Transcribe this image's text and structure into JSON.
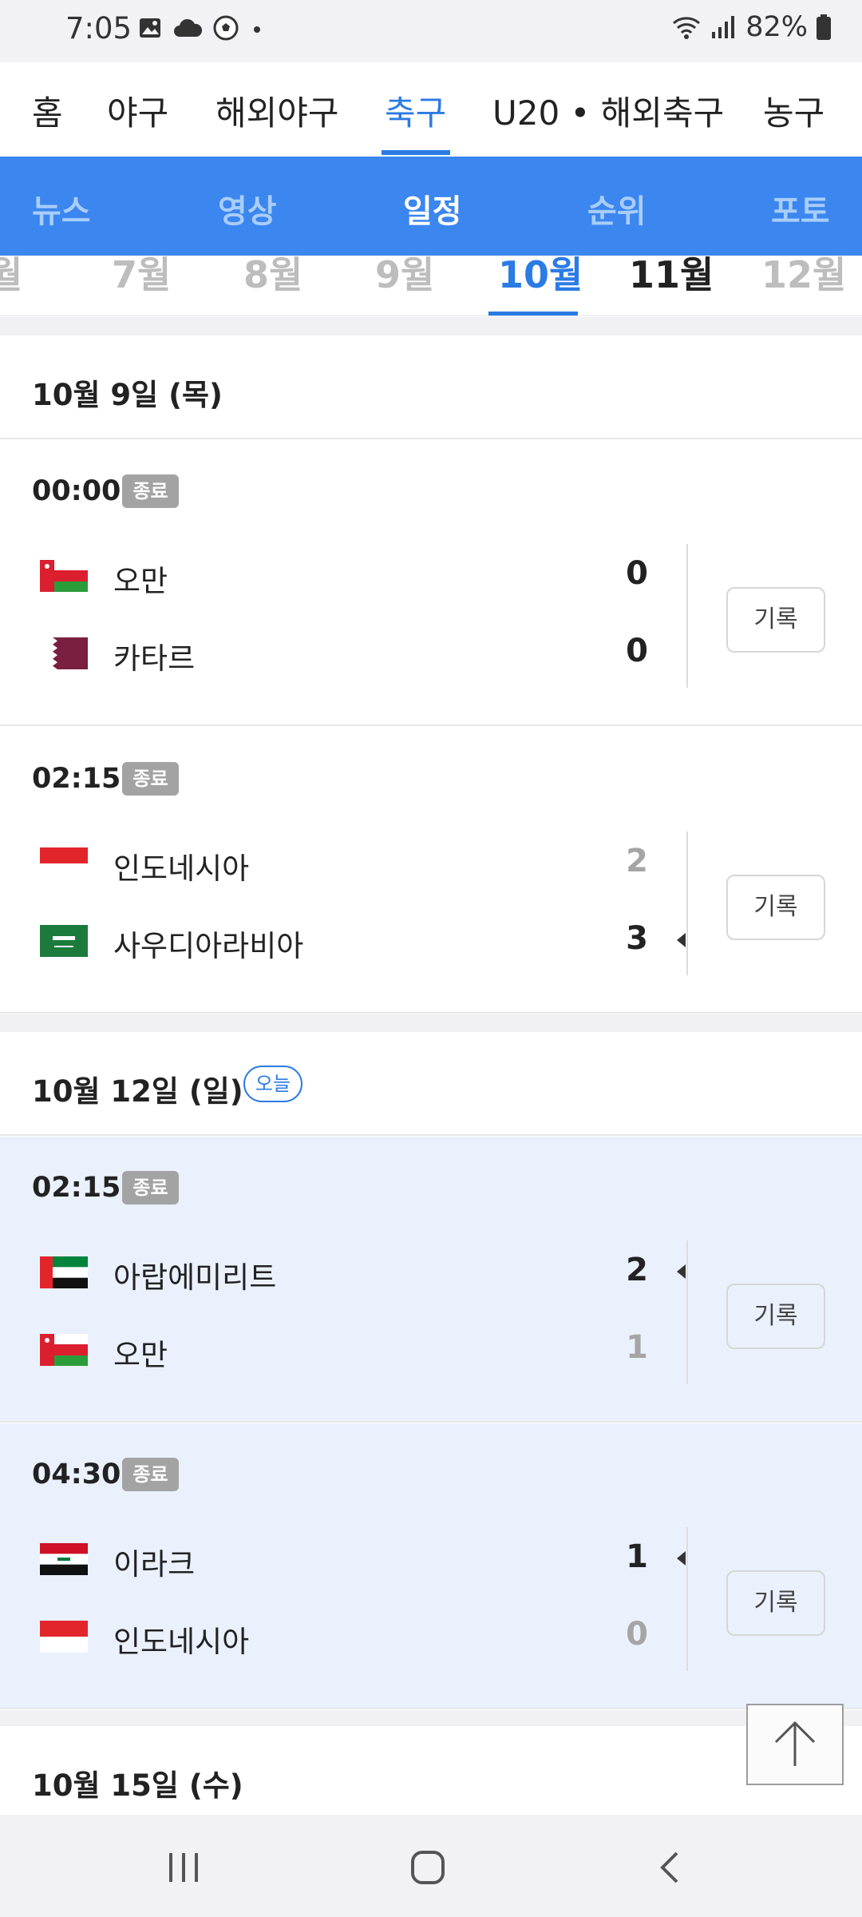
{
  "status_bar": {
    "time": "7:05",
    "battery": "82%"
  },
  "top_nav": {
    "items": [
      "홈",
      "야구",
      "해외야구",
      "축구",
      "U20 • 해외축구",
      "농구"
    ],
    "active": "축구"
  },
  "sub_nav": {
    "items": [
      "뉴스",
      "영상",
      "일정",
      "순위",
      "포토"
    ],
    "active": "일정"
  },
  "month_bar": {
    "items": [
      "월",
      "7월",
      "8월",
      "9월",
      "10월",
      "11월",
      "12월"
    ],
    "active": "10월"
  },
  "sections": [
    {
      "date": "10월 9일 (목)",
      "today_label": "",
      "matches": [
        {
          "time": "00:00",
          "status": "종료",
          "record_label": "기록",
          "home": {
            "name": "오만",
            "score": "0",
            "flag": "oman-flag",
            "winner": false
          },
          "away": {
            "name": "카타르",
            "score": "0",
            "flag": "qatar-flag",
            "winner": false
          }
        },
        {
          "time": "02:15",
          "status": "종료",
          "record_label": "기록",
          "home": {
            "name": "인도네시아",
            "score": "2",
            "flag": "indonesia-flag",
            "winner": false
          },
          "away": {
            "name": "사우디아라비아",
            "score": "3",
            "flag": "saudi-arabia-flag",
            "winner": true
          }
        }
      ]
    },
    {
      "date": "10월 12일 (일)",
      "today_label": "오늘",
      "matches": [
        {
          "time": "02:15",
          "status": "종료",
          "record_label": "기록",
          "home": {
            "name": "아랍에미리트",
            "score": "2",
            "flag": "uae-flag",
            "winner": true
          },
          "away": {
            "name": "오만",
            "score": "1",
            "flag": "oman-flag",
            "winner": false
          }
        },
        {
          "time": "04:30",
          "status": "종료",
          "record_label": "기록",
          "home": {
            "name": "이라크",
            "score": "1",
            "flag": "iraq-flag",
            "winner": true
          },
          "away": {
            "name": "인도네시아",
            "score": "0",
            "flag": "indonesia-flag",
            "winner": false
          }
        }
      ]
    },
    {
      "date": "10월 15일 (수)",
      "today_label": "",
      "matches": []
    }
  ],
  "colors": {
    "accent": "#2b7be4",
    "sub_nav_bg": "#3b86ef",
    "today_bg": "#eaf1fd",
    "badge_bg": "#a3a3a3"
  }
}
